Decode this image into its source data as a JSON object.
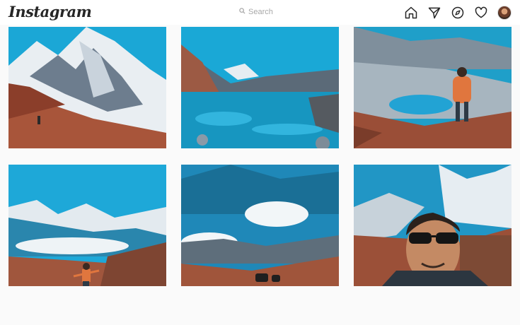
{
  "header": {
    "logo_text": "Instagram",
    "search_placeholder": "Search",
    "icons": [
      "home-icon",
      "direct-message-icon",
      "explore-icon",
      "heart-icon",
      "profile-avatar"
    ]
  },
  "colors": {
    "accent": "#262626",
    "sky": "#1fa6cf",
    "rock": "#a0503a"
  },
  "posts": [
    {
      "scene": "snow mountain with hiker on red slope"
    },
    {
      "scene": "blue glacial lake with rocks"
    },
    {
      "scene": "hiker standing above turquoise lake"
    },
    {
      "scene": "hiker with arms spread facing valley"
    },
    {
      "scene": "clouds over mountain trail with yaks"
    },
    {
      "scene": "selfie with sunglasses in mountains"
    }
  ]
}
